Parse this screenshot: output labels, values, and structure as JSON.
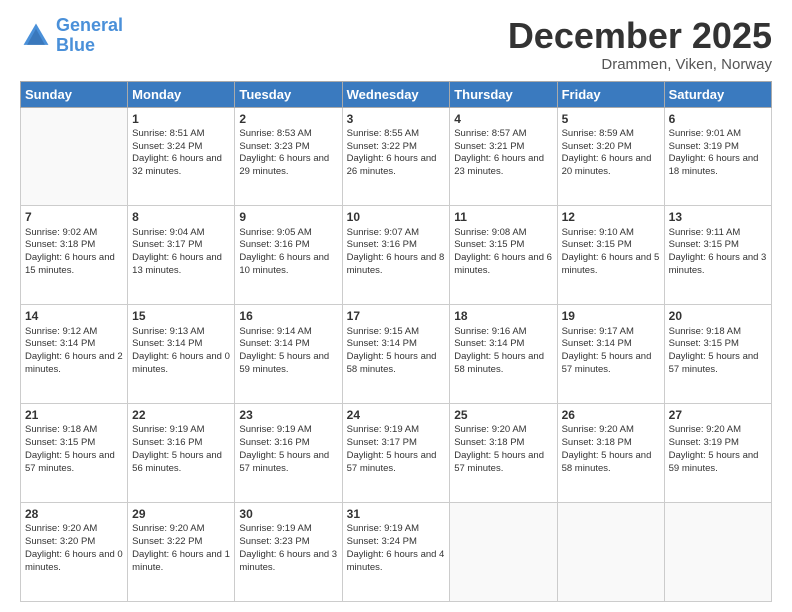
{
  "header": {
    "logo_line1": "General",
    "logo_line2": "Blue",
    "month": "December 2025",
    "location": "Drammen, Viken, Norway"
  },
  "weekdays": [
    "Sunday",
    "Monday",
    "Tuesday",
    "Wednesday",
    "Thursday",
    "Friday",
    "Saturday"
  ],
  "weeks": [
    [
      {
        "day": "",
        "sunrise": "",
        "sunset": "",
        "daylight": ""
      },
      {
        "day": "1",
        "sunrise": "Sunrise: 8:51 AM",
        "sunset": "Sunset: 3:24 PM",
        "daylight": "Daylight: 6 hours and 32 minutes."
      },
      {
        "day": "2",
        "sunrise": "Sunrise: 8:53 AM",
        "sunset": "Sunset: 3:23 PM",
        "daylight": "Daylight: 6 hours and 29 minutes."
      },
      {
        "day": "3",
        "sunrise": "Sunrise: 8:55 AM",
        "sunset": "Sunset: 3:22 PM",
        "daylight": "Daylight: 6 hours and 26 minutes."
      },
      {
        "day": "4",
        "sunrise": "Sunrise: 8:57 AM",
        "sunset": "Sunset: 3:21 PM",
        "daylight": "Daylight: 6 hours and 23 minutes."
      },
      {
        "day": "5",
        "sunrise": "Sunrise: 8:59 AM",
        "sunset": "Sunset: 3:20 PM",
        "daylight": "Daylight: 6 hours and 20 minutes."
      },
      {
        "day": "6",
        "sunrise": "Sunrise: 9:01 AM",
        "sunset": "Sunset: 3:19 PM",
        "daylight": "Daylight: 6 hours and 18 minutes."
      }
    ],
    [
      {
        "day": "7",
        "sunrise": "Sunrise: 9:02 AM",
        "sunset": "Sunset: 3:18 PM",
        "daylight": "Daylight: 6 hours and 15 minutes."
      },
      {
        "day": "8",
        "sunrise": "Sunrise: 9:04 AM",
        "sunset": "Sunset: 3:17 PM",
        "daylight": "Daylight: 6 hours and 13 minutes."
      },
      {
        "day": "9",
        "sunrise": "Sunrise: 9:05 AM",
        "sunset": "Sunset: 3:16 PM",
        "daylight": "Daylight: 6 hours and 10 minutes."
      },
      {
        "day": "10",
        "sunrise": "Sunrise: 9:07 AM",
        "sunset": "Sunset: 3:16 PM",
        "daylight": "Daylight: 6 hours and 8 minutes."
      },
      {
        "day": "11",
        "sunrise": "Sunrise: 9:08 AM",
        "sunset": "Sunset: 3:15 PM",
        "daylight": "Daylight: 6 hours and 6 minutes."
      },
      {
        "day": "12",
        "sunrise": "Sunrise: 9:10 AM",
        "sunset": "Sunset: 3:15 PM",
        "daylight": "Daylight: 6 hours and 5 minutes."
      },
      {
        "day": "13",
        "sunrise": "Sunrise: 9:11 AM",
        "sunset": "Sunset: 3:15 PM",
        "daylight": "Daylight: 6 hours and 3 minutes."
      }
    ],
    [
      {
        "day": "14",
        "sunrise": "Sunrise: 9:12 AM",
        "sunset": "Sunset: 3:14 PM",
        "daylight": "Daylight: 6 hours and 2 minutes."
      },
      {
        "day": "15",
        "sunrise": "Sunrise: 9:13 AM",
        "sunset": "Sunset: 3:14 PM",
        "daylight": "Daylight: 6 hours and 0 minutes."
      },
      {
        "day": "16",
        "sunrise": "Sunrise: 9:14 AM",
        "sunset": "Sunset: 3:14 PM",
        "daylight": "Daylight: 5 hours and 59 minutes."
      },
      {
        "day": "17",
        "sunrise": "Sunrise: 9:15 AM",
        "sunset": "Sunset: 3:14 PM",
        "daylight": "Daylight: 5 hours and 58 minutes."
      },
      {
        "day": "18",
        "sunrise": "Sunrise: 9:16 AM",
        "sunset": "Sunset: 3:14 PM",
        "daylight": "Daylight: 5 hours and 58 minutes."
      },
      {
        "day": "19",
        "sunrise": "Sunrise: 9:17 AM",
        "sunset": "Sunset: 3:14 PM",
        "daylight": "Daylight: 5 hours and 57 minutes."
      },
      {
        "day": "20",
        "sunrise": "Sunrise: 9:18 AM",
        "sunset": "Sunset: 3:15 PM",
        "daylight": "Daylight: 5 hours and 57 minutes."
      }
    ],
    [
      {
        "day": "21",
        "sunrise": "Sunrise: 9:18 AM",
        "sunset": "Sunset: 3:15 PM",
        "daylight": "Daylight: 5 hours and 57 minutes."
      },
      {
        "day": "22",
        "sunrise": "Sunrise: 9:19 AM",
        "sunset": "Sunset: 3:16 PM",
        "daylight": "Daylight: 5 hours and 56 minutes."
      },
      {
        "day": "23",
        "sunrise": "Sunrise: 9:19 AM",
        "sunset": "Sunset: 3:16 PM",
        "daylight": "Daylight: 5 hours and 57 minutes."
      },
      {
        "day": "24",
        "sunrise": "Sunrise: 9:19 AM",
        "sunset": "Sunset: 3:17 PM",
        "daylight": "Daylight: 5 hours and 57 minutes."
      },
      {
        "day": "25",
        "sunrise": "Sunrise: 9:20 AM",
        "sunset": "Sunset: 3:18 PM",
        "daylight": "Daylight: 5 hours and 57 minutes."
      },
      {
        "day": "26",
        "sunrise": "Sunrise: 9:20 AM",
        "sunset": "Sunset: 3:18 PM",
        "daylight": "Daylight: 5 hours and 58 minutes."
      },
      {
        "day": "27",
        "sunrise": "Sunrise: 9:20 AM",
        "sunset": "Sunset: 3:19 PM",
        "daylight": "Daylight: 5 hours and 59 minutes."
      }
    ],
    [
      {
        "day": "28",
        "sunrise": "Sunrise: 9:20 AM",
        "sunset": "Sunset: 3:20 PM",
        "daylight": "Daylight: 6 hours and 0 minutes."
      },
      {
        "day": "29",
        "sunrise": "Sunrise: 9:20 AM",
        "sunset": "Sunset: 3:22 PM",
        "daylight": "Daylight: 6 hours and 1 minute."
      },
      {
        "day": "30",
        "sunrise": "Sunrise: 9:19 AM",
        "sunset": "Sunset: 3:23 PM",
        "daylight": "Daylight: 6 hours and 3 minutes."
      },
      {
        "day": "31",
        "sunrise": "Sunrise: 9:19 AM",
        "sunset": "Sunset: 3:24 PM",
        "daylight": "Daylight: 6 hours and 4 minutes."
      },
      {
        "day": "",
        "sunrise": "",
        "sunset": "",
        "daylight": ""
      },
      {
        "day": "",
        "sunrise": "",
        "sunset": "",
        "daylight": ""
      },
      {
        "day": "",
        "sunrise": "",
        "sunset": "",
        "daylight": ""
      }
    ]
  ]
}
